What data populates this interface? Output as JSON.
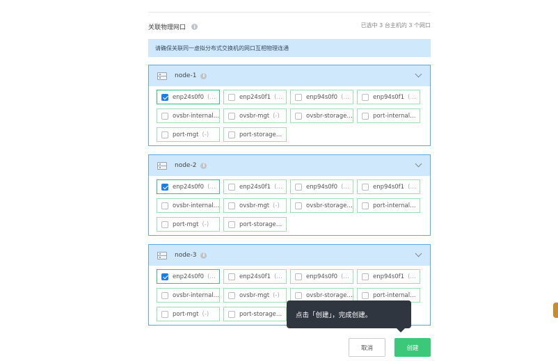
{
  "section": {
    "title": "关联物理网口",
    "info_icon": "i",
    "summary": "已选中 3 台主机的 3 个网口"
  },
  "notice": "请确保关联同一虚拟分布式交换机的网口互相物理连通",
  "nodes": [
    {
      "name": "node-1",
      "ports": [
        {
          "label": "enp24s0f0",
          "suffix": "(…",
          "checked": true
        },
        {
          "label": "enp24s0f1",
          "suffix": "(…",
          "checked": false
        },
        {
          "label": "enp94s0f0",
          "suffix": "(…",
          "checked": false
        },
        {
          "label": "enp94s0f1",
          "suffix": "(…",
          "checked": false
        },
        {
          "label": "ovsbr-internal…",
          "suffix": "",
          "checked": false
        },
        {
          "label": "ovsbr-mgt",
          "suffix": "(-)",
          "checked": false
        },
        {
          "label": "ovsbr-storage…",
          "suffix": "",
          "checked": false
        },
        {
          "label": "port-internal…",
          "suffix": "",
          "checked": false
        },
        {
          "label": "port-mgt",
          "suffix": "(-)",
          "checked": false
        },
        {
          "label": "port-storage…",
          "suffix": "",
          "checked": false
        }
      ]
    },
    {
      "name": "node-2",
      "ports": [
        {
          "label": "enp24s0f0",
          "suffix": "(…",
          "checked": true
        },
        {
          "label": "enp24s0f1",
          "suffix": "(…",
          "checked": false
        },
        {
          "label": "enp94s0f0",
          "suffix": "(…",
          "checked": false
        },
        {
          "label": "enp94s0f1",
          "suffix": "(…",
          "checked": false
        },
        {
          "label": "ovsbr-internal…",
          "suffix": "",
          "checked": false
        },
        {
          "label": "ovsbr-mgt",
          "suffix": "(-)",
          "checked": false
        },
        {
          "label": "ovsbr-storage…",
          "suffix": "",
          "checked": false
        },
        {
          "label": "port-internal…",
          "suffix": "",
          "checked": false
        },
        {
          "label": "port-mgt",
          "suffix": "(-)",
          "checked": false
        },
        {
          "label": "port-storage…",
          "suffix": "",
          "checked": false
        }
      ]
    },
    {
      "name": "node-3",
      "ports": [
        {
          "label": "enp24s0f0",
          "suffix": "(…",
          "checked": true
        },
        {
          "label": "enp24s0f1",
          "suffix": "(…",
          "checked": false
        },
        {
          "label": "enp94s0f0",
          "suffix": "(…",
          "checked": false
        },
        {
          "label": "enp94s0f1",
          "suffix": "(…",
          "checked": false
        },
        {
          "label": "ovsbr-internal…",
          "suffix": "",
          "checked": false
        },
        {
          "label": "ovsbr-mgt",
          "suffix": "(-)",
          "checked": false
        },
        {
          "label": "ovsbr-storage…",
          "suffix": "",
          "checked": false
        },
        {
          "label": "port-internal…",
          "suffix": "",
          "checked": false
        },
        {
          "label": "port-mgt",
          "suffix": "(-)",
          "checked": false
        },
        {
          "label": "port-storage…",
          "suffix": "",
          "checked": false
        }
      ]
    }
  ],
  "tooltip": "点击「创建」，完成创建。",
  "buttons": {
    "cancel": "取消",
    "create": "创建"
  },
  "colors": {
    "accent_green": "#3cc879",
    "checkbox_blue": "#1d7fe0",
    "header_blue": "#cfe8fb",
    "border_blue": "#5aa9e6",
    "tooltip_bg": "#2f3640"
  }
}
